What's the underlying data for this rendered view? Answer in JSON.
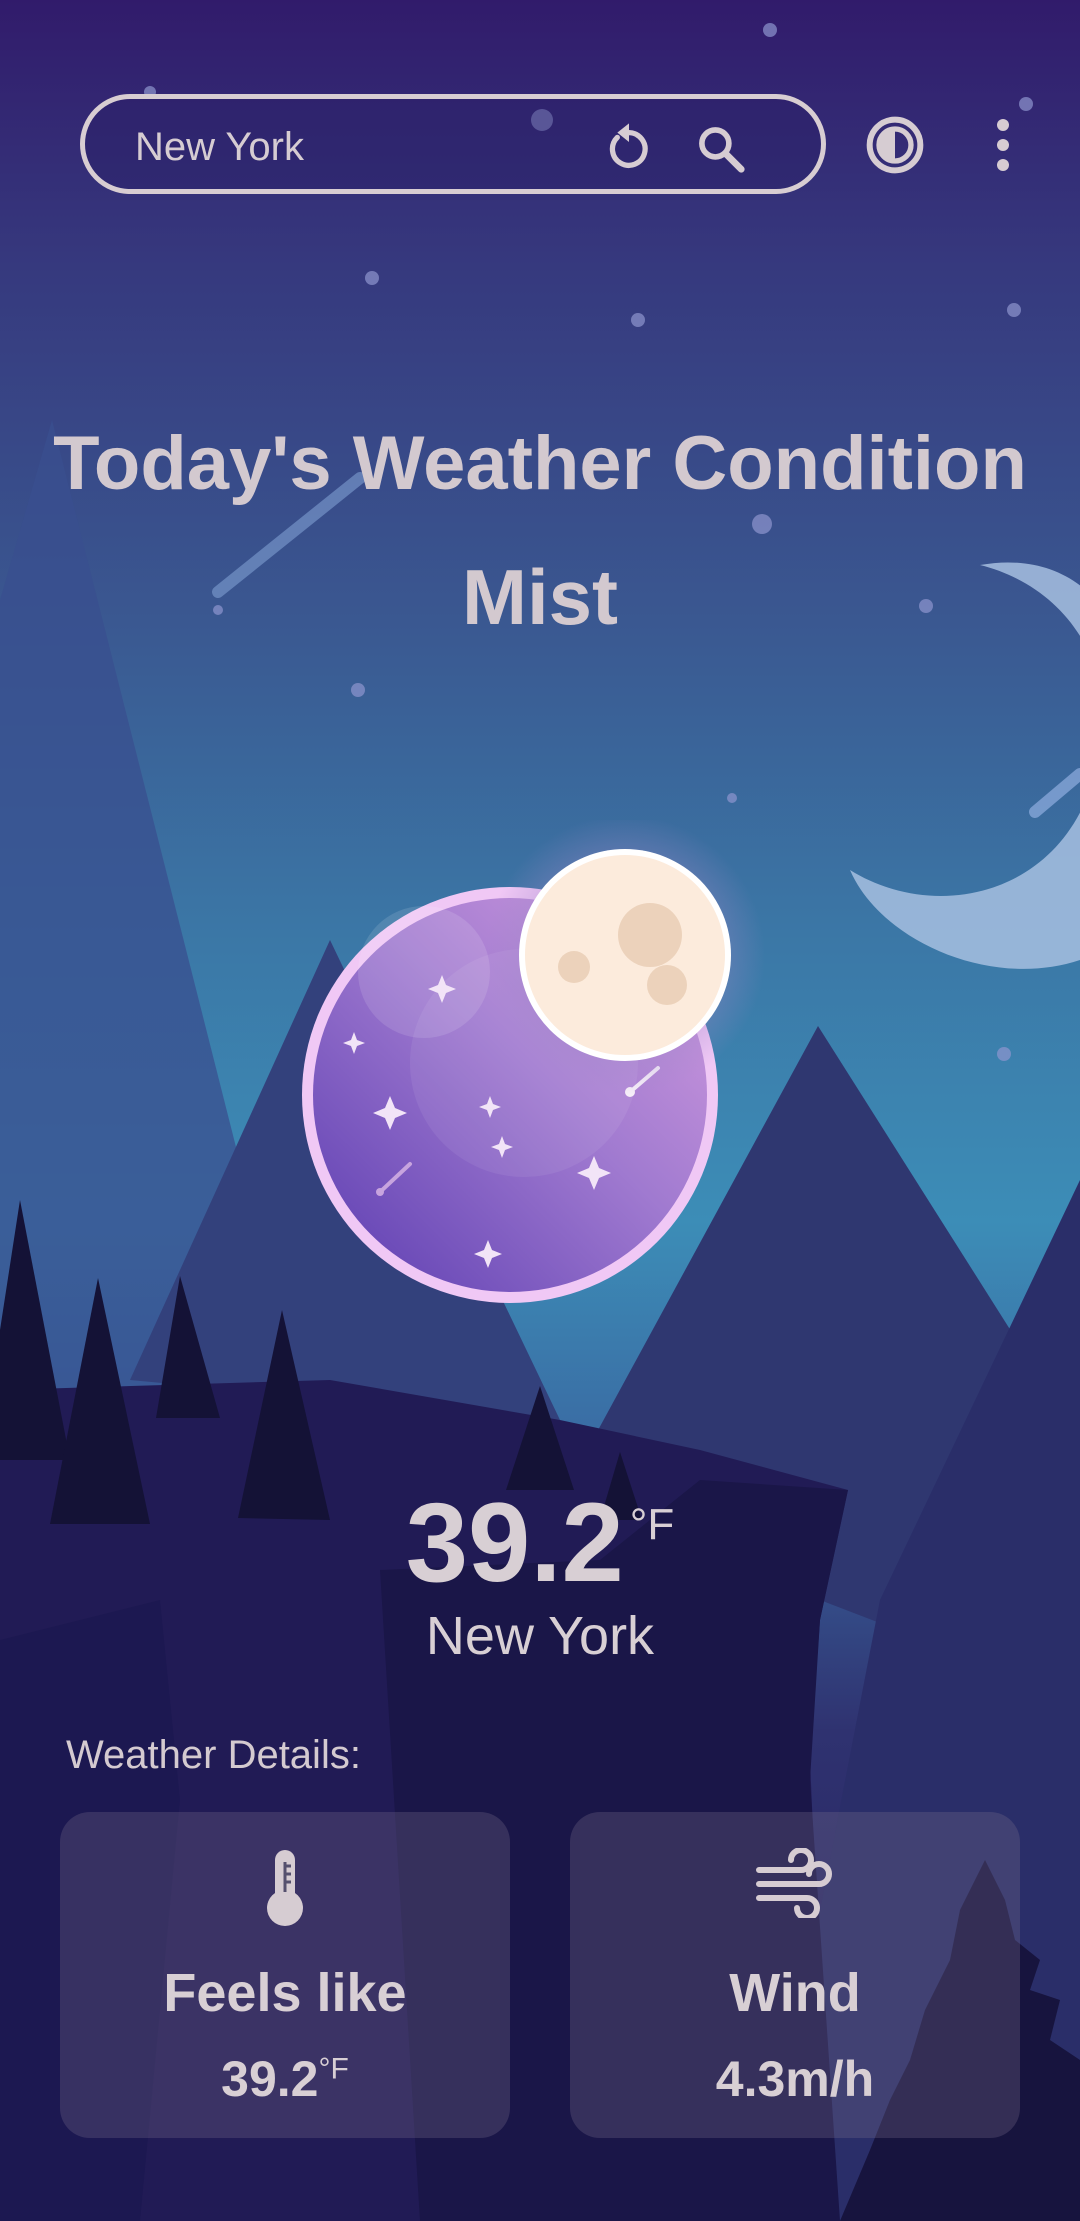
{
  "search": {
    "value": "New York",
    "placeholder": ""
  },
  "header": {
    "refresh_icon": "refresh-icon",
    "search_icon": "search-icon",
    "theme_icon": "theme-toggle-icon",
    "menu_icon": "more-vert-icon"
  },
  "hero": {
    "title": "Today's Weather Condition",
    "condition": "Mist"
  },
  "current": {
    "temperature": "39.2",
    "unit": "°F",
    "city": "New York"
  },
  "details": {
    "heading": "Weather Details:",
    "cards": [
      {
        "icon": "thermometer-icon",
        "label": "Feels like",
        "value": "39.2",
        "unit": "°F"
      },
      {
        "icon": "wind-icon",
        "label": "Wind",
        "value": "4.3m/h"
      }
    ]
  },
  "colors": {
    "text": "#d6ccd2",
    "sky_top": "#311b6b",
    "sky_mid": "#3c8db7",
    "ground": "#221c58",
    "planet": "#9b6fd0",
    "moon": "#fcebdc"
  }
}
